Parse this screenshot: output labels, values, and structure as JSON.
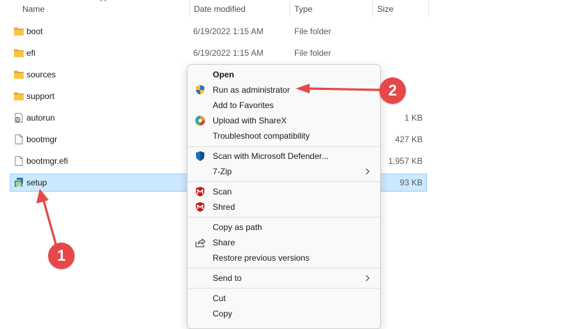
{
  "header": {
    "name_label": "Name",
    "date_label": "Date modified",
    "type_label": "Type",
    "size_label": "Size"
  },
  "files": [
    {
      "name": "boot",
      "date": "6/19/2022 1:15 AM",
      "type": "File folder",
      "size": "",
      "icon": "folder-icon"
    },
    {
      "name": "efi",
      "date": "6/19/2022 1:15 AM",
      "type": "File folder",
      "size": "",
      "icon": "folder-icon"
    },
    {
      "name": "sources",
      "date": "",
      "type": "",
      "size": "",
      "icon": "folder-icon"
    },
    {
      "name": "support",
      "date": "",
      "type": "",
      "size": "",
      "icon": "folder-icon"
    },
    {
      "name": "autorun",
      "date": "",
      "type": "",
      "size": "1 KB",
      "icon": "settings-file-icon"
    },
    {
      "name": "bootmgr",
      "date": "",
      "type": "",
      "size": "427 KB",
      "icon": "file-icon"
    },
    {
      "name": "bootmgr.efi",
      "date": "",
      "type": "",
      "size": "1,957 KB",
      "icon": "file-icon"
    },
    {
      "name": "setup",
      "date": "",
      "type": "",
      "size": "93 KB",
      "icon": "setup-icon",
      "selected": true
    }
  ],
  "context_menu": {
    "open": "Open",
    "run_as_admin": "Run as administrator",
    "add_to_favorites": "Add to Favorites",
    "upload_sharex": "Upload with ShareX",
    "troubleshoot": "Troubleshoot compatibility",
    "scan_defender": "Scan with Microsoft Defender...",
    "seven_zip": "7-Zip",
    "scan": "Scan",
    "shred": "Shred",
    "copy_as_path": "Copy as path",
    "share": "Share",
    "restore_versions": "Restore previous versions",
    "send_to": "Send to",
    "cut": "Cut",
    "copy": "Copy"
  },
  "annotations": {
    "step1": "1",
    "step2": "2"
  },
  "colors": {
    "selection_bg": "#cce8ff",
    "selection_border": "#99d1ff",
    "annotation_red": "#e54848",
    "folder_yellow": "#f8c643",
    "mcafee_red": "#c01818",
    "defender_blue": "#1f6fbf"
  }
}
